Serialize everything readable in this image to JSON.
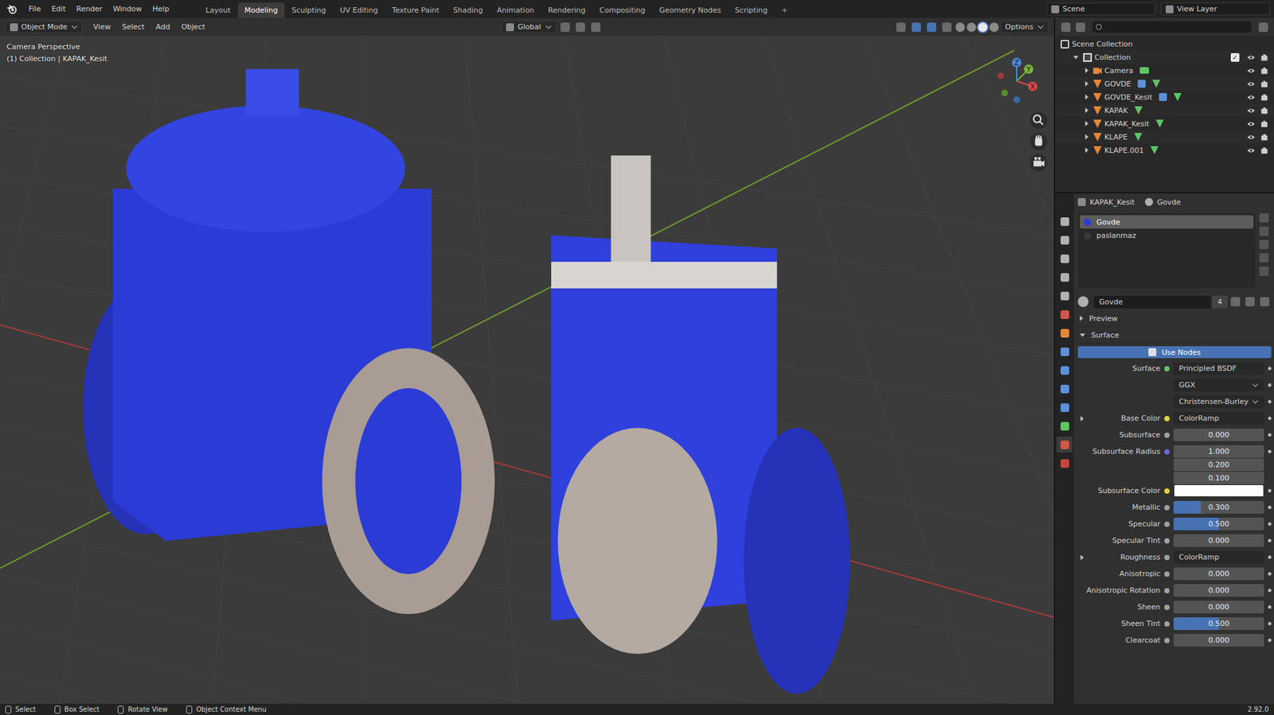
{
  "window": {
    "title": "Blender"
  },
  "top_menu": [
    "File",
    "Edit",
    "Render",
    "Window",
    "Help"
  ],
  "workspaces": [
    {
      "label": "Layout",
      "selected": false
    },
    {
      "label": "Modeling",
      "selected": true
    },
    {
      "label": "Sculpting",
      "selected": false
    },
    {
      "label": "UV Editing",
      "selected": false
    },
    {
      "label": "Texture Paint",
      "selected": false
    },
    {
      "label": "Shading",
      "selected": false
    },
    {
      "label": "Animation",
      "selected": false
    },
    {
      "label": "Rendering",
      "selected": false
    },
    {
      "label": "Compositing",
      "selected": false
    },
    {
      "label": "Geometry Nodes",
      "selected": false
    },
    {
      "label": "Scripting",
      "selected": false
    }
  ],
  "add_workspace": "+",
  "scene": "Scene",
  "view_layer": "View Layer",
  "viewport_header": {
    "mode": "Object Mode",
    "menus": [
      "View",
      "Select",
      "Add",
      "Object"
    ],
    "orientation": "Global",
    "options": "Options"
  },
  "viewport": {
    "overlay_lines": [
      "Camera Perspective",
      "(1) Collection | KAPAK_Kesit"
    ],
    "gizmo": [
      "X",
      "Y",
      "Z"
    ]
  },
  "outliner": {
    "items": [
      {
        "label": "Scene Collection",
        "kind": "scene",
        "expanded": true,
        "active": false,
        "has_modifier": false
      },
      {
        "label": "Collection",
        "kind": "collection",
        "expanded": true,
        "active": false,
        "has_modifier": false
      },
      {
        "label": "Camera",
        "kind": "camera",
        "expanded": false,
        "active": false,
        "has_modifier": false
      },
      {
        "label": "GOVDE",
        "kind": "mesh",
        "expanded": false,
        "active": false,
        "has_modifier": true
      },
      {
        "label": "GOVDE_Kesit",
        "kind": "mesh",
        "expanded": false,
        "active": false,
        "has_modifier": true
      },
      {
        "label": "KAPAK",
        "kind": "mesh",
        "expanded": false,
        "active": false,
        "has_modifier": false
      },
      {
        "label": "KAPAK_Kesit",
        "kind": "mesh",
        "expanded": false,
        "active": true,
        "has_modifier": false
      },
      {
        "label": "KLAPE",
        "kind": "mesh",
        "expanded": false,
        "active": false,
        "has_modifier": false
      },
      {
        "label": "KLAPE.001",
        "kind": "mesh",
        "expanded": false,
        "active": false,
        "has_modifier": false
      }
    ]
  },
  "property_tabs": [
    {
      "selected": false,
      "color": "#b0b0b0"
    },
    {
      "selected": false,
      "color": "#b0b0b0"
    },
    {
      "selected": false,
      "color": "#b0b0b0"
    },
    {
      "selected": false,
      "color": "#b0b0b0"
    },
    {
      "selected": false,
      "color": "#b0b0b0"
    },
    {
      "selected": false,
      "color": "#d0584a"
    },
    {
      "selected": false,
      "color": "#e3873a"
    },
    {
      "selected": false,
      "color": "#5f8fd6"
    },
    {
      "selected": false,
      "color": "#5f8fd6"
    },
    {
      "selected": false,
      "color": "#5f8fd6"
    },
    {
      "selected": false,
      "color": "#5f8fd6"
    },
    {
      "selected": false,
      "color": "#5ec463"
    },
    {
      "selected": true,
      "color": "#d0584a"
    },
    {
      "selected": false,
      "color": "#c4473d"
    }
  ],
  "properties": {
    "object": "KAPAK_Kesit",
    "material_tab": "Govde",
    "slots": [
      {
        "label": "Govde",
        "selected": true
      },
      {
        "label": "paslanmaz",
        "selected": false
      }
    ],
    "material": {
      "name": "Govde",
      "users": "4"
    },
    "sections": [
      {
        "label": "Preview",
        "expanded": false
      },
      {
        "label": "Surface",
        "expanded": true
      }
    ],
    "use_nodes": "Use Nodes",
    "rows": [
      {
        "kind": "link",
        "label": "Surface",
        "value": "Principled BSDF",
        "color": "#5ec463",
        "expandable": false
      },
      {
        "kind": "dropdown",
        "value": "GGX"
      },
      {
        "kind": "dropdown",
        "value": "Christensen-Burley"
      },
      {
        "kind": "link",
        "label": "Base Color",
        "value": "ColorRamp",
        "color": "#e3d23a",
        "expandable": true
      },
      {
        "kind": "number",
        "label": "Subsurface",
        "value": "0.000",
        "level": 0,
        "color": "#a0a0a0"
      },
      {
        "kind": "vector",
        "label": "Subsurface Radius",
        "values": [
          "1.000",
          "0.200",
          "0.100"
        ],
        "color": "#6b6bd8"
      },
      {
        "kind": "swatch",
        "label": "Subsurface Color",
        "swatch": "#ffffff",
        "color": "#e3d23a"
      },
      {
        "kind": "number",
        "label": "Metallic",
        "value": "0.300",
        "level": 0.3,
        "color": "#a0a0a0"
      },
      {
        "kind": "number",
        "label": "Specular",
        "value": "0.500",
        "level": 0.5,
        "color": "#a0a0a0"
      },
      {
        "kind": "number",
        "label": "Specular Tint",
        "value": "0.000",
        "level": 0,
        "color": "#a0a0a0"
      },
      {
        "kind": "link",
        "label": "Roughness",
        "value": "ColorRamp",
        "color": "#a0a0a0",
        "expandable": true
      },
      {
        "kind": "number",
        "label": "Anisotropic",
        "value": "0.000",
        "level": 0,
        "color": "#a0a0a0"
      },
      {
        "kind": "number",
        "label": "Anisotropic Rotation",
        "value": "0.000",
        "level": 0,
        "color": "#a0a0a0"
      },
      {
        "kind": "number",
        "label": "Sheen",
        "value": "0.000",
        "level": 0,
        "color": "#a0a0a0"
      },
      {
        "kind": "number",
        "label": "Sheen Tint",
        "value": "0.500",
        "level": 0.5,
        "color": "#a0a0a0"
      },
      {
        "kind": "number",
        "label": "Clearcoat",
        "value": "0.000",
        "level": 0,
        "color": "#a0a0a0"
      }
    ]
  },
  "status_bar": {
    "items": [
      "Select",
      "Box Select",
      "Rotate View",
      "Object Context Menu"
    ],
    "version": "2.92.0"
  }
}
